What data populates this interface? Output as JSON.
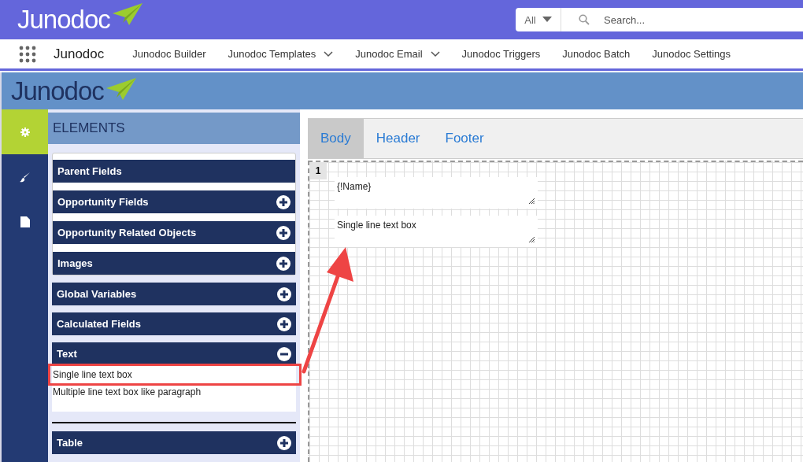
{
  "top_bar": {
    "logo": "Junodoc",
    "search": {
      "scope": "All",
      "placeholder": "Search..."
    }
  },
  "nav": {
    "app_name": "Junodoc",
    "items": [
      {
        "label": "Junodoc Builder",
        "dropdown": false
      },
      {
        "label": "Junodoc Templates",
        "dropdown": true
      },
      {
        "label": "Junodoc Email",
        "dropdown": true
      },
      {
        "label": "Junodoc Triggers",
        "dropdown": false
      },
      {
        "label": "Junodoc Batch",
        "dropdown": false
      },
      {
        "label": "Junodoc Settings",
        "dropdown": false
      }
    ]
  },
  "banner": {
    "logo": "Junodoc"
  },
  "rail": [
    {
      "kind": "gear",
      "selected": true
    },
    {
      "kind": "brush",
      "selected": false
    },
    {
      "kind": "file",
      "selected": false
    }
  ],
  "elements": {
    "title": "ELEMENTS",
    "card_sections": [
      {
        "label": "Parent Fields",
        "toggle": false
      },
      {
        "label": "Opportunity Fields",
        "toggle": true,
        "expanded": false
      },
      {
        "label": "Opportunity Related Objects",
        "toggle": true,
        "expanded": false
      },
      {
        "label": "Images",
        "toggle": true,
        "expanded": false
      }
    ],
    "sections": [
      {
        "label": "Global Variables",
        "toggle": true,
        "expanded": false
      },
      {
        "label": "Calculated Fields",
        "toggle": true,
        "expanded": false
      },
      {
        "label": "Text",
        "toggle": true,
        "expanded": true,
        "items": [
          {
            "label": "Single line text box",
            "highlighted": true
          },
          {
            "label": "Multiple line text box like paragraph",
            "highlighted": false
          }
        ]
      }
    ],
    "after_divider": [
      {
        "label": "Table",
        "toggle": true,
        "expanded": false
      }
    ]
  },
  "editor": {
    "tabs": [
      {
        "label": "Body",
        "selected": true
      },
      {
        "label": "Header",
        "selected": false
      },
      {
        "label": "Footer",
        "selected": false
      }
    ],
    "row_number": "1",
    "text_boxes": [
      "{!Name}",
      "Single line text box"
    ]
  }
}
